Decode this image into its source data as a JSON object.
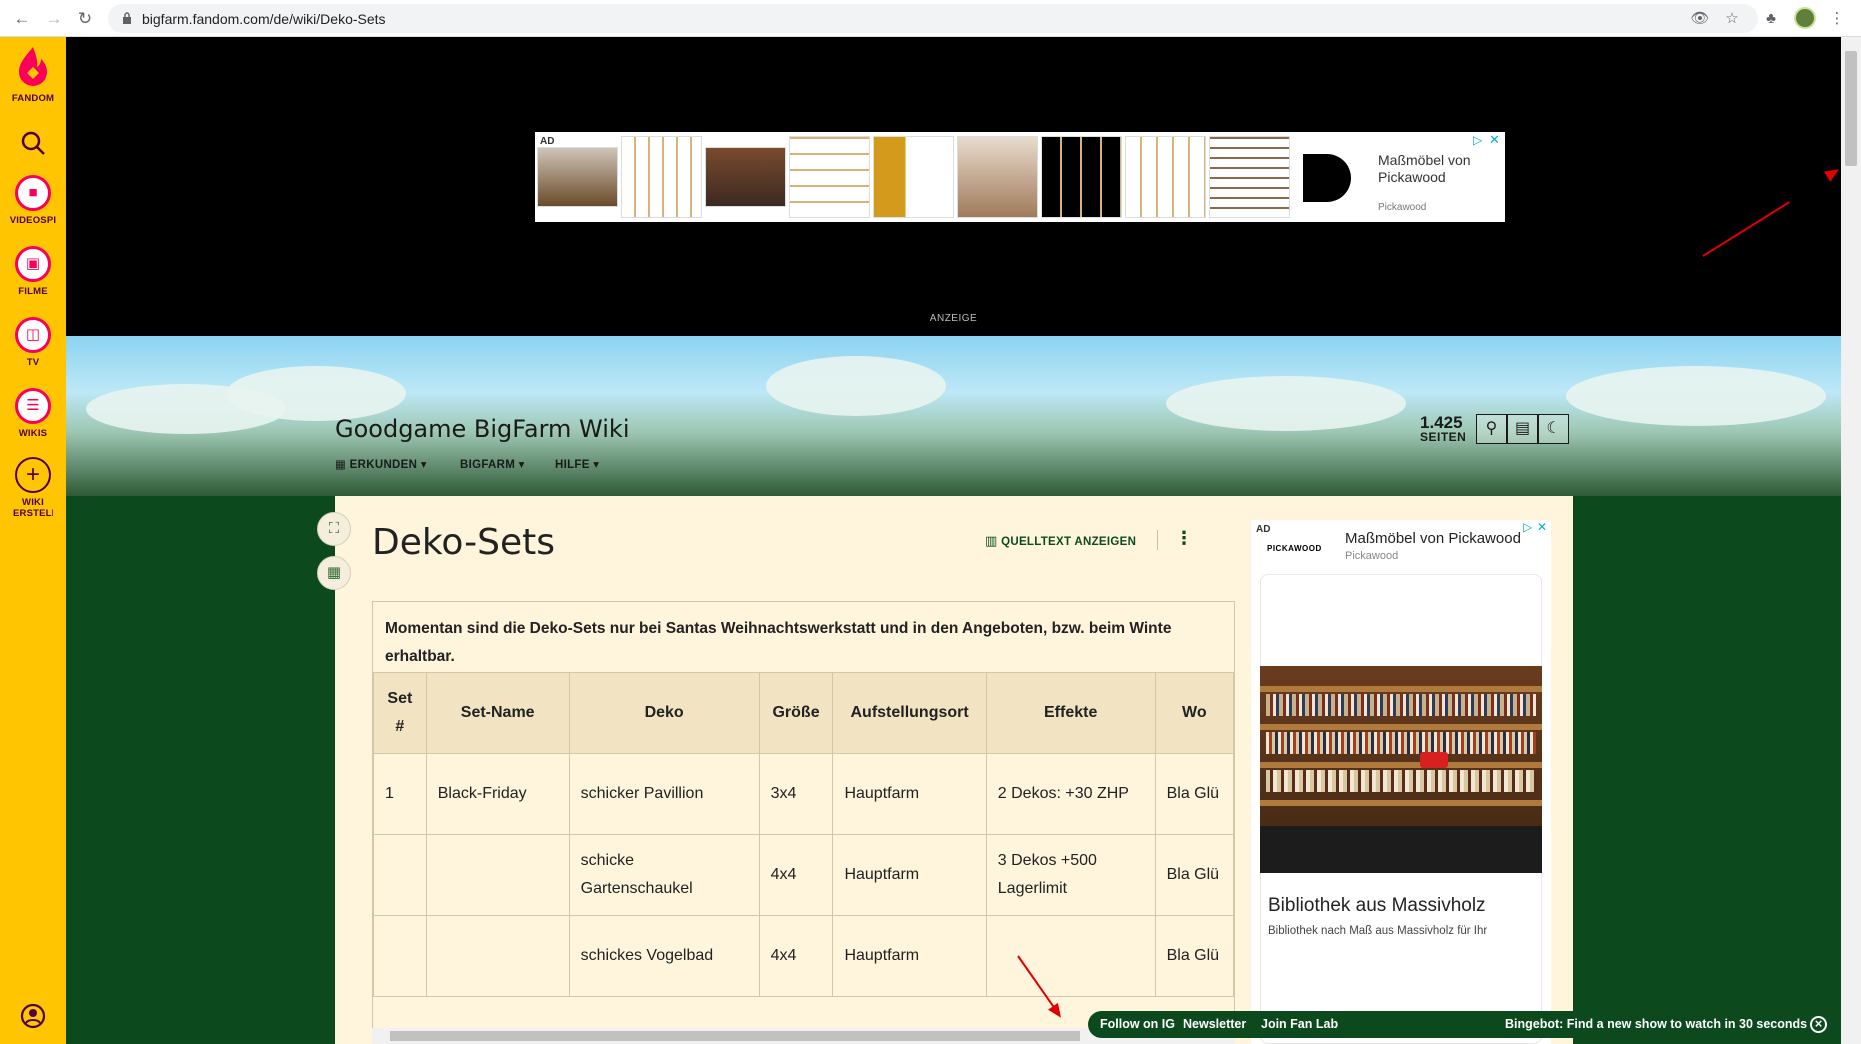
{
  "browser": {
    "url": "bigfarm.fandom.com/de/wiki/Deko-Sets"
  },
  "rail": {
    "items": [
      {
        "label": "FANDOM",
        "icon": "fandom-flame-icon"
      },
      {
        "label": "",
        "icon": "search-icon"
      },
      {
        "label": "VIDEOSPI",
        "icon": "gamepad-icon"
      },
      {
        "label": "FILME",
        "icon": "film-icon"
      },
      {
        "label": "TV",
        "icon": "tv-icon"
      },
      {
        "label": "WIKIS",
        "icon": "book-icon"
      },
      {
        "label": "WIKI ERSTELLE",
        "icon": "plus-icon"
      }
    ]
  },
  "top_ad": {
    "tag": "AD",
    "advertiser_line1": "Maßmöbel von",
    "advertiser_line2": "Pickawood",
    "advertiser_small": "Pickawood",
    "anzeige": "ANZEIGE"
  },
  "header": {
    "wiki_name": "Goodgame BigFarm Wiki",
    "nav": [
      "ERKUNDEN",
      "BIGFARM",
      "HILFE"
    ],
    "pages_count": "1.425",
    "pages_label": "SEITEN"
  },
  "article": {
    "title": "Deko-Sets",
    "source_button": "QUELLTEXT ANZEIGEN",
    "intro_line1": "Momentan sind die Deko-Sets nur bei Santas Weihnachtswerkstatt und in den Angeboten, bzw. beim Winte",
    "intro_line2": "erhaltbar.",
    "table": {
      "headers": [
        "Set #",
        "Set-Name",
        "Deko",
        "Größe",
        "Aufstellungsort",
        "Effekte",
        "Wo"
      ],
      "rows": [
        [
          "1",
          "Black-Friday",
          "schicker Pavillion",
          "3x4",
          "Hauptfarm",
          "2 Dekos: +30 ZHP",
          "Bla Glü"
        ],
        [
          "",
          "",
          "schicke Gartenschaukel",
          "4x4",
          "Hauptfarm",
          "3 Dekos +500 Lagerlimit",
          "Bla Glü"
        ],
        [
          "",
          "",
          "schickes Vogelbad",
          "4x4",
          "Hauptfarm",
          "",
          "Bla Glü"
        ]
      ]
    }
  },
  "rail_ad": {
    "tag": "AD",
    "brand_logo_text": "PICKAWOOD",
    "title": "Maßmöbel von Pickawood",
    "subtitle": "Pickawood",
    "headline": "Bibliothek aus Massivholz",
    "body": "Bibliothek nach Maß aus Massivholz für Ihr"
  },
  "bottom_bar": {
    "follow": "Follow on IG",
    "newsletter": "Newsletter",
    "fanlab": "Join Fan Lab",
    "bingebot": "Bingebot: Find a new show to watch in 30 seconds"
  },
  "colors": {
    "fandom_yellow": "#ffc500",
    "wiki_green": "#0c4a1e",
    "card_bg": "#fff4dc",
    "table_header": "#f2e3c3",
    "annotation_red": "#e00000"
  }
}
